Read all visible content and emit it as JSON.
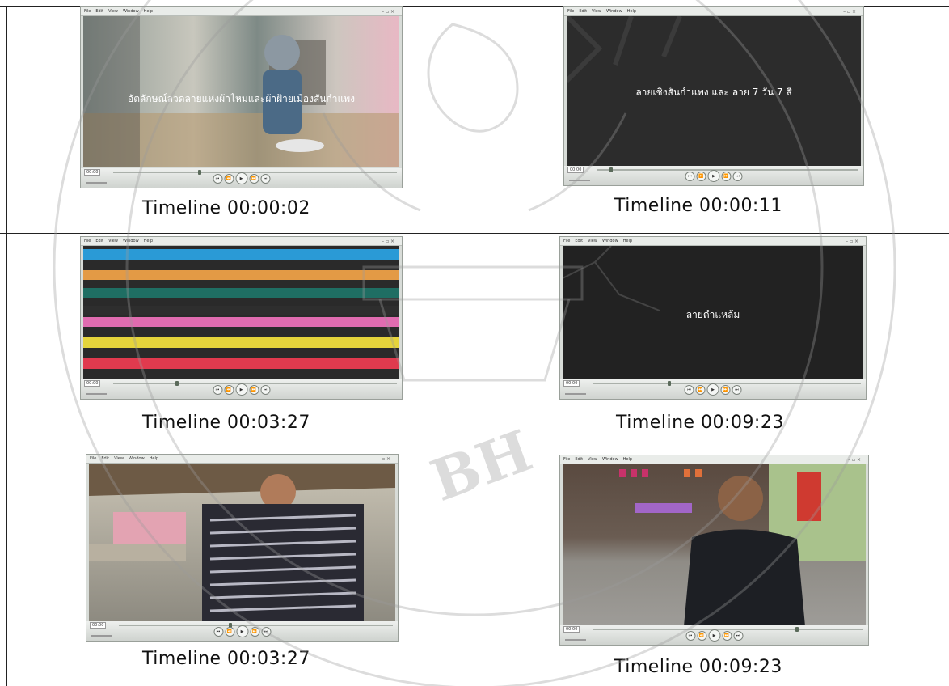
{
  "menu_labels": [
    "File",
    "Edit",
    "View",
    "Window",
    "Help"
  ],
  "window_buttons": "– ▫ ×",
  "frames": [
    {
      "caption": "Timeline  00:00:02",
      "overlay_text": "อัตลักษณ์ลวดลายแห่งผ้าไหมและผ้าฝ้ายเมืองสันกำแพง",
      "scene": "animated character in a room"
    },
    {
      "caption": "Timeline  00:00:11",
      "overlay_text": "ลายเชิงสันกำแพง และ ลาย 7 วัน 7 สี",
      "scene": "dark title card"
    },
    {
      "caption": "Timeline  00:03:27",
      "overlay_text": "",
      "scene": "colorful striped fabric"
    },
    {
      "caption": "Timeline  00:09:23",
      "overlay_text": "ลายดำแหล้ม",
      "scene": "dark title card"
    },
    {
      "caption": "Timeline  00:03:27",
      "overlay_text": "",
      "scene": "woman holding striped cloth"
    },
    {
      "caption": "Timeline  00:09:23",
      "overlay_text": "",
      "scene": "man speaking outdoors"
    }
  ],
  "watermark_text": "BH",
  "colors": {
    "grid": "#222222",
    "player_chrome": "#d8dcd8",
    "watermark": "#9a9a9a"
  }
}
